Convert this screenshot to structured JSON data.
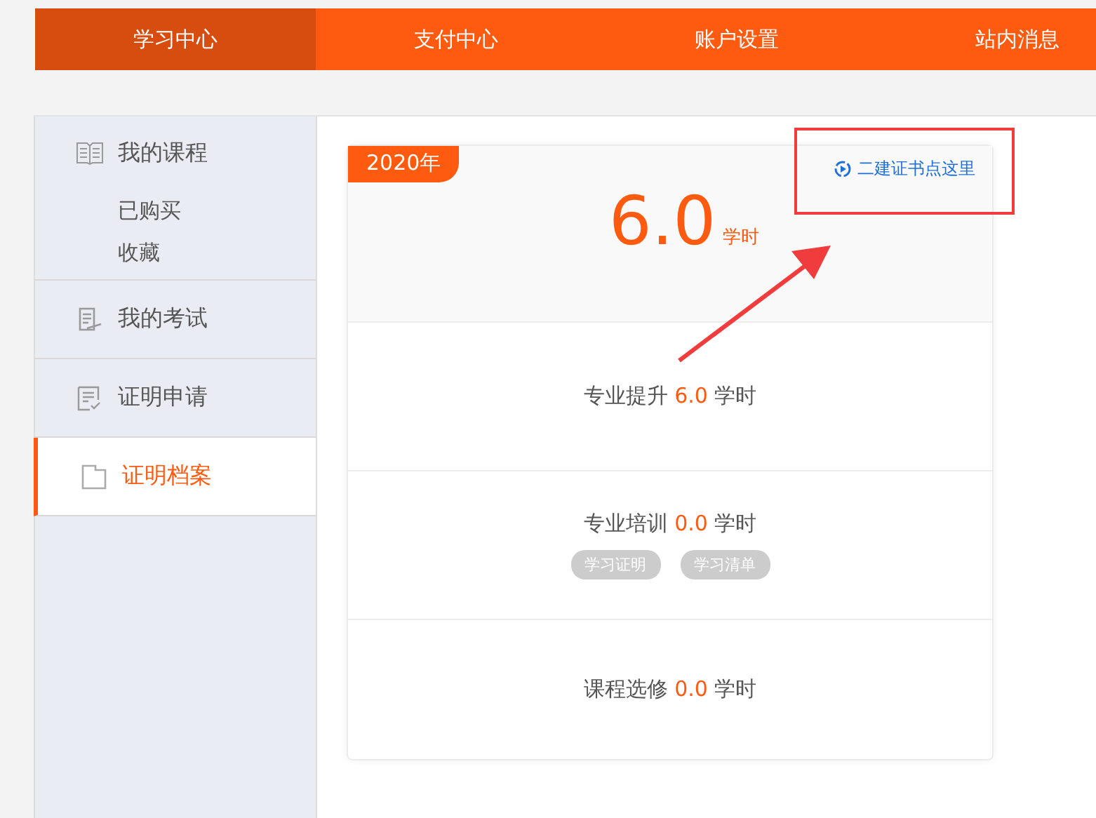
{
  "nav": [
    {
      "label": "学习中心",
      "selected": true
    },
    {
      "label": "支付中心",
      "selected": false
    },
    {
      "label": "账户设置",
      "selected": false
    },
    {
      "label": "站内消息",
      "selected": false
    }
  ],
  "sidebar": {
    "items": [
      {
        "label": "我的课程",
        "kind": "book",
        "selected": false,
        "children": [
          {
            "label": "已购买"
          },
          {
            "label": "收藏"
          }
        ]
      },
      {
        "label": "我的考试",
        "kind": "exam",
        "selected": false
      },
      {
        "label": "证明申请",
        "kind": "checklist",
        "selected": false
      },
      {
        "label": "证明档案",
        "kind": "folder",
        "selected": true
      }
    ]
  },
  "card": {
    "year": "2020年",
    "link": "二建证书点这里",
    "total": "6.0",
    "total_unit": "学时",
    "rows": [
      {
        "label": "专业提升",
        "value": "6.0",
        "unit": "学时"
      },
      {
        "label": "专业培训",
        "value": "0.0",
        "unit": "学时",
        "tags": [
          "学习证明",
          "学习清单"
        ]
      },
      {
        "label": "课程选修",
        "value": "0.0",
        "unit": "学时"
      }
    ]
  }
}
